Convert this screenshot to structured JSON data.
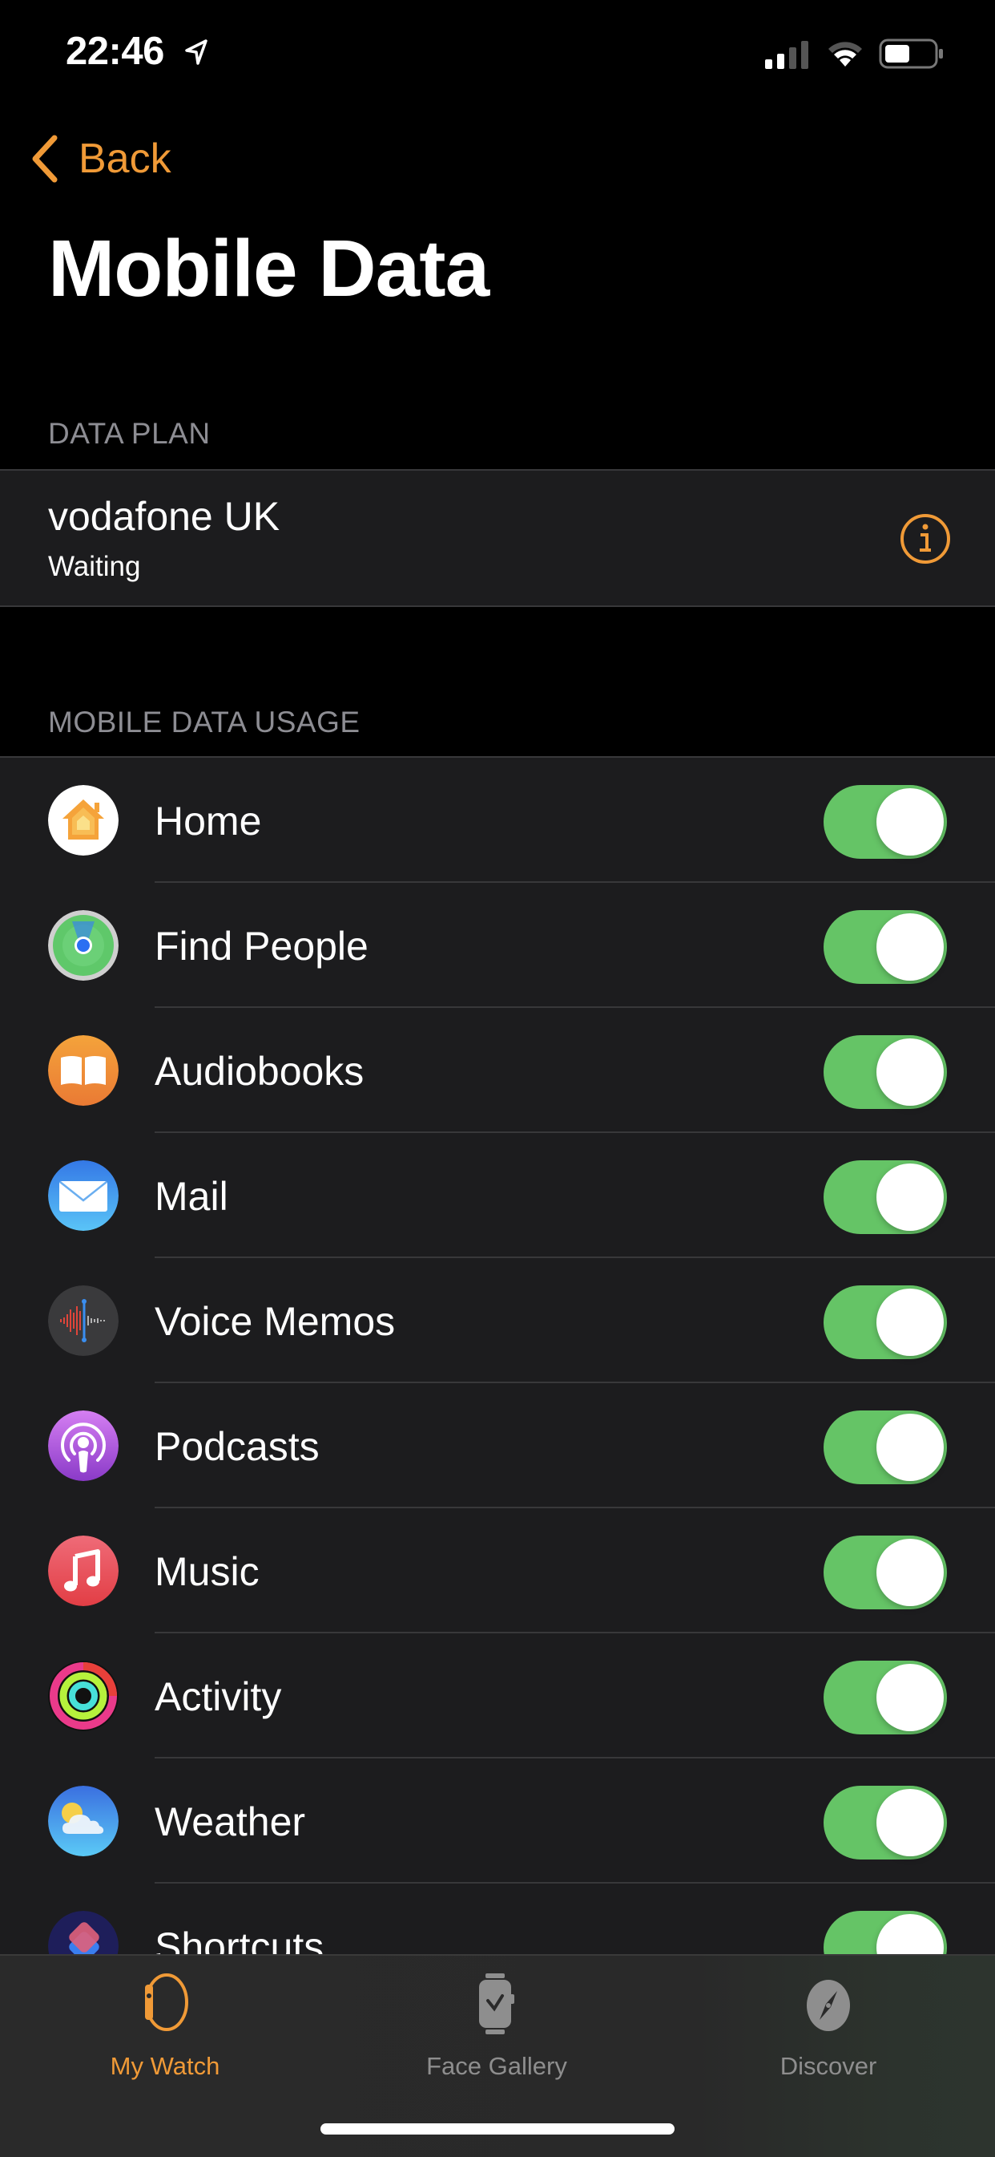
{
  "status_bar": {
    "time": "22:46",
    "icons": [
      "location-arrow-icon",
      "cellular-signal-icon",
      "wifi-icon",
      "battery-icon"
    ]
  },
  "nav": {
    "back_label": "Back",
    "title": "Mobile Data"
  },
  "data_plan": {
    "header": "DATA PLAN",
    "carrier": "vodafone UK",
    "status": "Waiting",
    "accent_color": "#f09a37"
  },
  "usage": {
    "header": "MOBILE DATA USAGE",
    "toggle_on_color": "#65c466",
    "apps": [
      {
        "name": "Home",
        "icon": "home-app-icon",
        "enabled": true
      },
      {
        "name": "Find People",
        "icon": "find-people-app-icon",
        "enabled": true
      },
      {
        "name": "Audiobooks",
        "icon": "audiobooks-app-icon",
        "enabled": true
      },
      {
        "name": "Mail",
        "icon": "mail-app-icon",
        "enabled": true
      },
      {
        "name": "Voice Memos",
        "icon": "voice-memos-app-icon",
        "enabled": true
      },
      {
        "name": "Podcasts",
        "icon": "podcasts-app-icon",
        "enabled": true
      },
      {
        "name": "Music",
        "icon": "music-app-icon",
        "enabled": true
      },
      {
        "name": "Activity",
        "icon": "activity-app-icon",
        "enabled": true
      },
      {
        "name": "Weather",
        "icon": "weather-app-icon",
        "enabled": true
      },
      {
        "name": "Shortcuts",
        "icon": "shortcuts-app-icon",
        "enabled": true
      }
    ]
  },
  "tabbar": {
    "tabs": [
      {
        "label": "My Watch",
        "icon": "watch-icon",
        "active": true
      },
      {
        "label": "Face Gallery",
        "icon": "face-gallery-icon",
        "active": false
      },
      {
        "label": "Discover",
        "icon": "compass-icon",
        "active": false
      }
    ]
  }
}
